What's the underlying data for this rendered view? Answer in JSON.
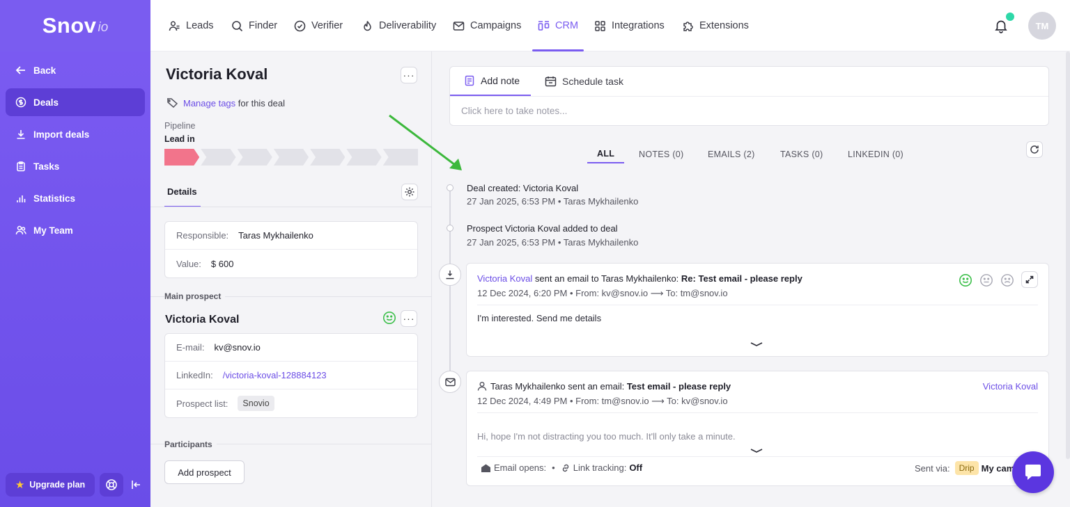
{
  "brand": {
    "logo_main": "Snov",
    "logo_sub": "io"
  },
  "sidebar": {
    "items": [
      {
        "label": "Back",
        "icon": "arrow-left-icon"
      },
      {
        "label": "Deals",
        "icon": "dollar-circle-icon",
        "active": true
      },
      {
        "label": "Import deals",
        "icon": "download-icon"
      },
      {
        "label": "Tasks",
        "icon": "clipboard-icon"
      },
      {
        "label": "Statistics",
        "icon": "bar-chart-icon"
      },
      {
        "label": "My Team",
        "icon": "team-icon"
      }
    ],
    "upgrade_label": "Upgrade plan"
  },
  "topnav": {
    "items": [
      {
        "label": "Leads",
        "icon": "users-icon"
      },
      {
        "label": "Finder",
        "icon": "search-icon"
      },
      {
        "label": "Verifier",
        "icon": "check-circle-icon"
      },
      {
        "label": "Deliverability",
        "icon": "flame-icon"
      },
      {
        "label": "Campaigns",
        "icon": "envelope-icon"
      },
      {
        "label": "CRM",
        "icon": "crm-icon",
        "active": true
      },
      {
        "label": "Integrations",
        "icon": "grid-icon"
      },
      {
        "label": "Extensions",
        "icon": "puzzle-icon"
      }
    ],
    "avatar_initials": "TM"
  },
  "deal": {
    "title": "Victoria Koval",
    "manage_tags_link": "Manage tags",
    "manage_tags_suffix": "for this deal",
    "pipeline_label": "Pipeline",
    "stage": "Lead in",
    "pipeline_stage_index": 1,
    "pipeline_stage_count": 7,
    "details_tab": "Details",
    "responsible_label": "Responsible:",
    "responsible_value": "Taras Mykhailenko",
    "value_label": "Value:",
    "value_value": "$ 600",
    "main_prospect_label": "Main prospect",
    "prospect_name": "Victoria Koval",
    "email_label": "E-mail:",
    "email_value": "kv@snov.io",
    "linkedin_label": "LinkedIn:",
    "linkedin_value": "/victoria-koval-128884123",
    "prospect_list_label": "Prospect list:",
    "prospect_list_value": "Snovio",
    "participants_label": "Participants",
    "add_prospect_label": "Add prospect"
  },
  "notes": {
    "tab_add_note": "Add note",
    "tab_schedule_task": "Schedule task",
    "placeholder": "Click here to take notes..."
  },
  "filters": [
    {
      "label": "ALL",
      "active": true
    },
    {
      "label": "NOTES (0)"
    },
    {
      "label": "EMAILS (2)"
    },
    {
      "label": "TASKS (0)"
    },
    {
      "label": "LINKEDIN (0)"
    }
  ],
  "timeline": {
    "event1_title": "Deal created: Victoria Koval",
    "event1_meta": "27 Jan 2025, 6:53 PM • Taras Mykhailenko",
    "event2_title": "Prospect Victoria Koval added to deal",
    "event2_meta": "27 Jan 2025, 6:53 PM • Taras Mykhailenko",
    "email1": {
      "sender": "Victoria Koval",
      "action": "sent an email to Taras Mykhailenko:",
      "subject": "Re: Test email - please reply",
      "meta": "12 Dec 2024, 6:20 PM • From: kv@snov.io ⟶ To: tm@snov.io",
      "body": "I'm interested. Send me details"
    },
    "email2": {
      "action": "Taras Mykhailenko sent an email:",
      "subject": "Test email - please reply",
      "recipient": "Victoria Koval",
      "meta": "12 Dec 2024, 4:49 PM • From: tm@snov.io ⟶ To: kv@snov.io",
      "body": "Hi, hope I'm not distracting you too much. It'll only take a minute.",
      "opens_label": "Email opens:",
      "opens_sep": "•",
      "tracking_label": "Link tracking:",
      "tracking_value": "Off",
      "sent_via_label": "Sent via:",
      "drip_badge": "Drip",
      "campaign_name": "My cam"
    }
  },
  "colors": {
    "accent": "#7a5cf0",
    "sidebar": "#6a4de8",
    "pipeline_active": "#f2748b",
    "positive": "#3cbf4a",
    "arrow": "#3cb83c"
  }
}
